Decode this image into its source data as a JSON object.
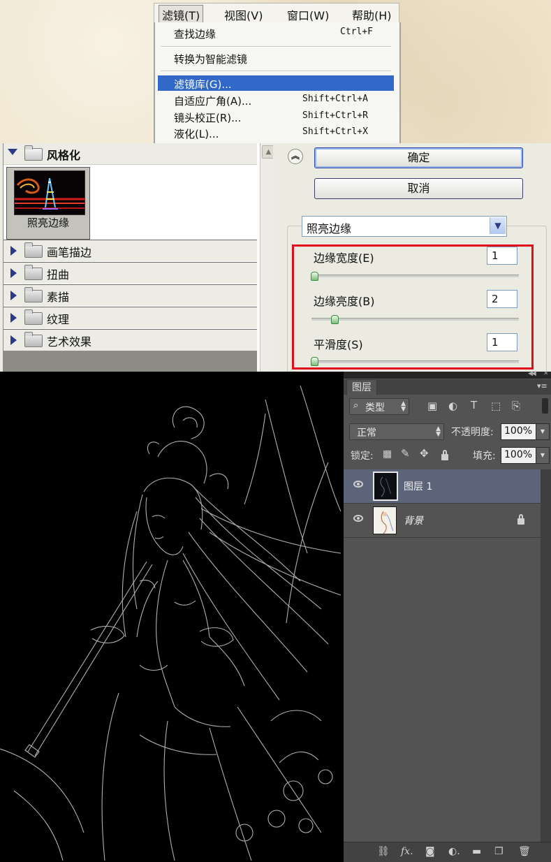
{
  "menubar": {
    "items": [
      "滤镜(T)",
      "视图(V)",
      "窗口(W)",
      "帮助(H)"
    ]
  },
  "filter_menu": {
    "items": [
      {
        "label": "查找边缘",
        "shortcut": "Ctrl+F"
      },
      {
        "label": "转换为智能滤镜",
        "shortcut": ""
      },
      {
        "label": "滤镜库(G)...",
        "shortcut": ""
      },
      {
        "label": "自适应广角(A)...",
        "shortcut": "Shift+Ctrl+A"
      },
      {
        "label": "镜头校正(R)...",
        "shortcut": "Shift+Ctrl+R"
      },
      {
        "label": "液化(L)...",
        "shortcut": "Shift+Ctrl+X"
      }
    ]
  },
  "gallery": {
    "expanded_category": "风格化",
    "selected_filter": "照亮边缘",
    "categories": [
      "画笔描边",
      "扭曲",
      "素描",
      "纹理",
      "艺术效果"
    ]
  },
  "controls": {
    "collapse_icon": "double-chevron-up-icon",
    "ok_label": "确定",
    "cancel_label": "取消",
    "filter_select": "照亮边缘",
    "params": [
      {
        "label": "边缘宽度(E)",
        "value": "1",
        "fraction": 0.0
      },
      {
        "label": "边缘亮度(B)",
        "value": "2",
        "fraction": 0.1
      },
      {
        "label": "平滑度(S)",
        "value": "1",
        "fraction": 0.0
      }
    ],
    "highlight_color": "#e10e1c"
  },
  "layers_panel": {
    "tab": "图层",
    "filter_kind": "类型",
    "blend_mode": "正常",
    "opacity_label": "不透明度:",
    "opacity_value": "100%",
    "lock_label": "锁定:",
    "fill_label": "填充:",
    "fill_value": "100%",
    "layers": [
      {
        "name": "图层 1",
        "selected": true,
        "locked": false
      },
      {
        "name": "背景",
        "selected": false,
        "locked": true
      }
    ],
    "selected_color": "#5b6478"
  }
}
